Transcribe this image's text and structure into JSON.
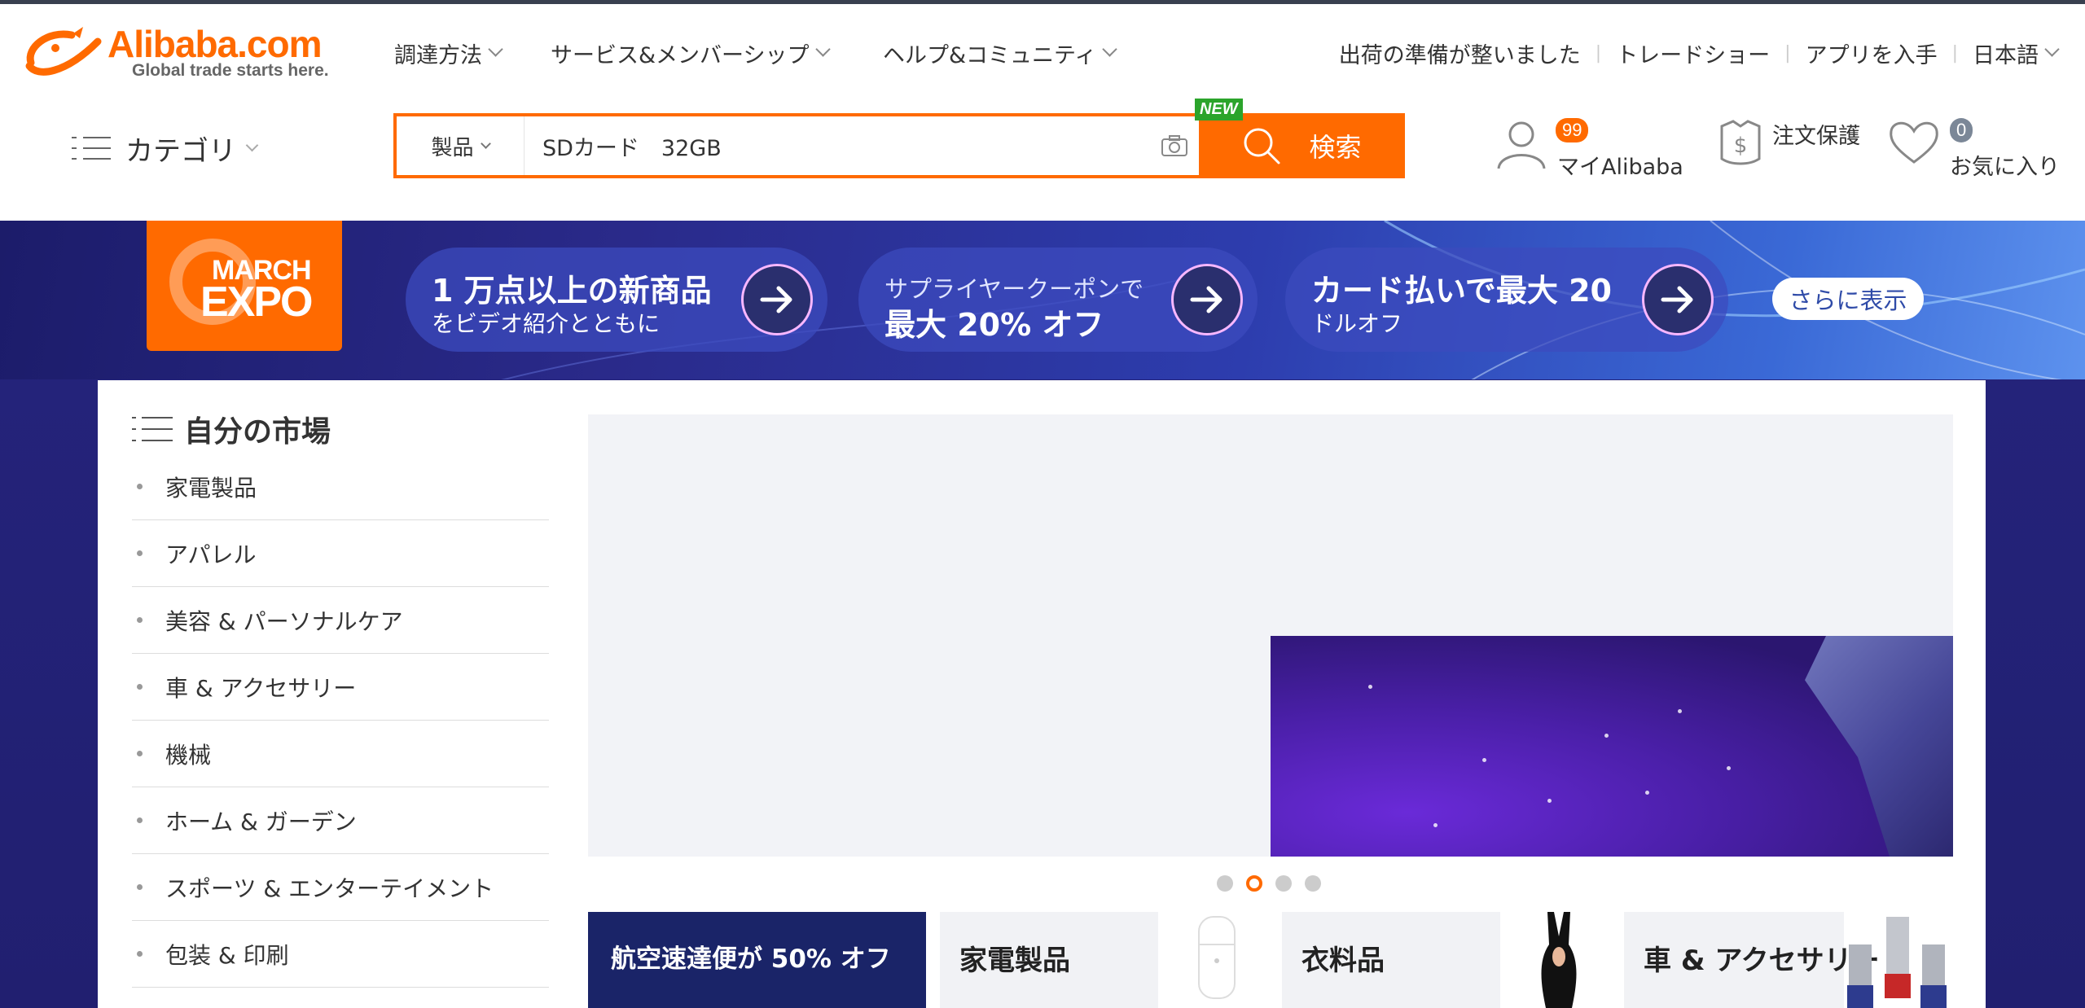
{
  "colors": {
    "brand": "#ff6a00",
    "dark_navy": "#1a2468",
    "new_badge": "#2ba42b"
  },
  "logo": {
    "word": "Alibaba.com",
    "tagline": "Global trade starts here."
  },
  "topnav": {
    "sourcing": "調達方法",
    "services": "サービス&メンバーシップ",
    "help": "ヘルプ&コミュニティ",
    "ready_to_ship": "出荷の準備が整いました",
    "trade_show": "トレードショー",
    "get_app": "アプリを入手",
    "language": "日本語"
  },
  "categories_label": "カテゴリ",
  "search": {
    "type": "製品",
    "value": "SDカード　32GB",
    "new_badge": "NEW",
    "button": "検索",
    "camera_icon": "camera-icon"
  },
  "utility": {
    "my_alibaba": {
      "badge": "99",
      "label": "マイAlibaba"
    },
    "order_protection": {
      "label": "注文保護"
    },
    "favorites": {
      "badge": "0",
      "label": "お気に入り"
    }
  },
  "banner": {
    "expo_line1": "MARCH",
    "expo_line2": "EXPO",
    "promo1": {
      "line1": "1 万点以上の新商品",
      "line2": "をビデオ紹介とともに"
    },
    "promo2": {
      "line1": "サプライヤークーポンで",
      "line2": "最大 20% オフ"
    },
    "promo3": {
      "line1": "カード払いで最大 20",
      "line2": "ドルオフ"
    },
    "more": "さらに表示"
  },
  "market": {
    "title": "自分の市場",
    "items": [
      "家電製品",
      "アパレル",
      "美容 & パーソナルケア",
      "車 & アクセサリー",
      "機械",
      "ホーム & ガーデン",
      "スポーツ & エンターテイメント",
      "包装 & 印刷"
    ]
  },
  "carousel": {
    "active_index": 1,
    "count": 4
  },
  "tiles": {
    "air": "航空速達便が 50% オフ",
    "electronics": "家電製品",
    "apparel": "衣料品",
    "vehicles": "車 & アクセサリー"
  }
}
